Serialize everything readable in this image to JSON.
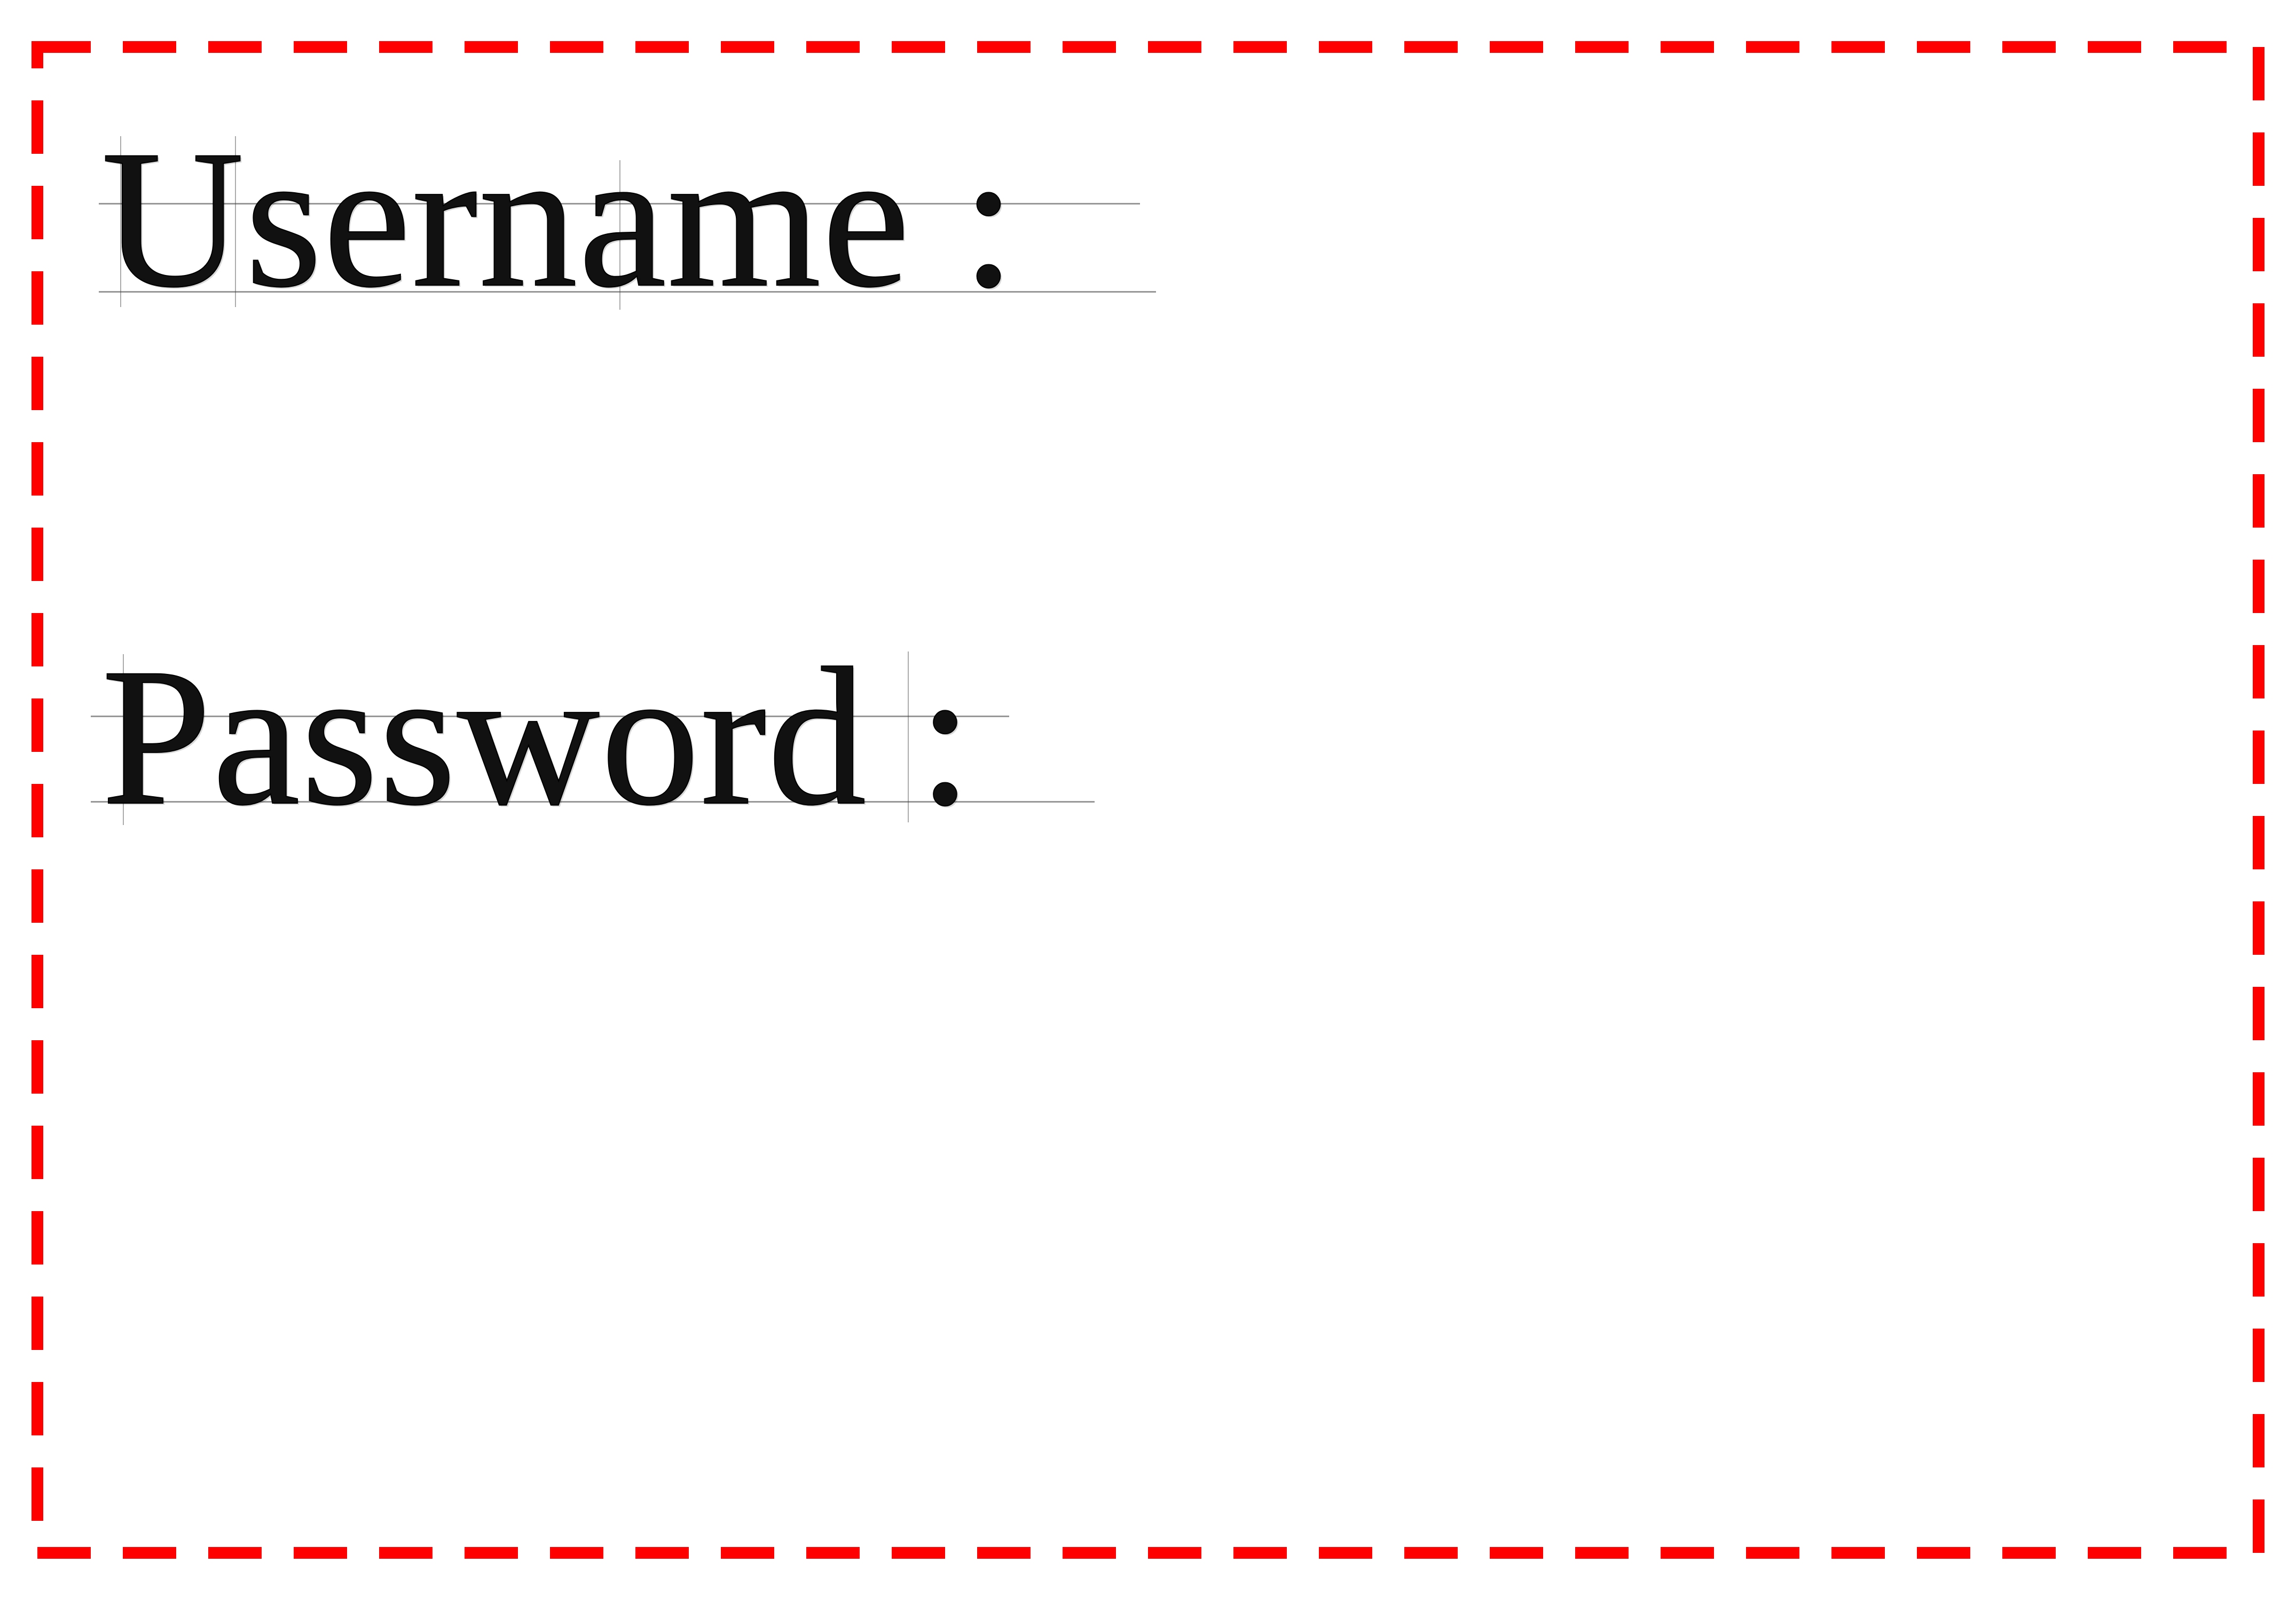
{
  "form": {
    "username_label": "Username :",
    "password_label": "Password :",
    "username_value": "",
    "password_value": ""
  },
  "colors": {
    "frame": "#ff0000",
    "text": "#111111",
    "background": "#ffffff"
  }
}
